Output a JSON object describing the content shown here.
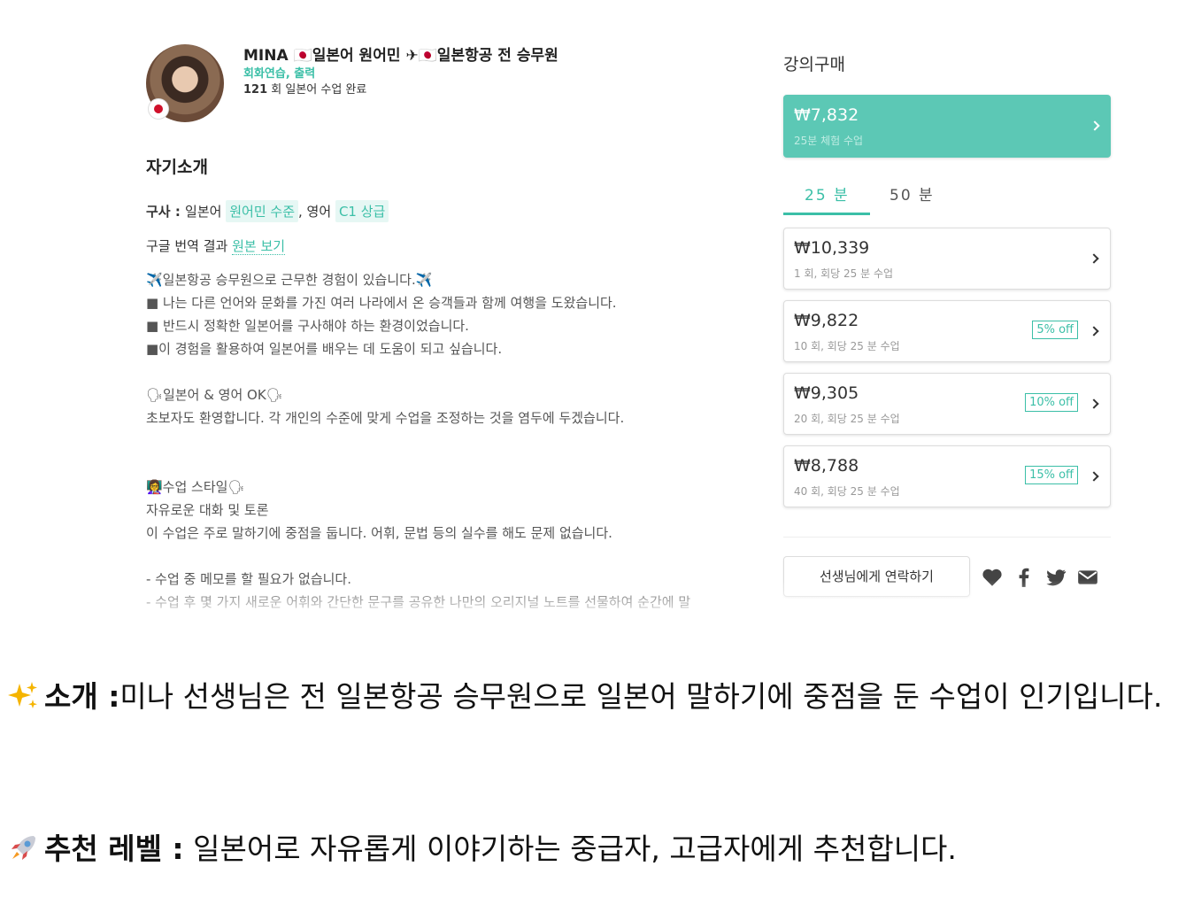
{
  "profile": {
    "name": "MINA 🇯🇵일본어 원어민 ✈🇯🇵일본항공 전 승무원",
    "skills": "회화연습, 출력",
    "lessons_count": "121",
    "lessons_text": " 회 일본어 수업 완료"
  },
  "intro": {
    "title": "자기소개",
    "speaks_label": "구사 : ",
    "lang1": "일본어",
    "lang1_level": "원어민 수준",
    "lang2": ", 영어",
    "lang2_level": "C1 상급",
    "translate_text": "구글 번역 결과",
    "translate_link": "원본 보기",
    "lines": [
      "✈️일본항공 승무원으로 근무한 경험이 있습니다.✈️",
      "■ 나는 다른 언어와 문화를 가진 여러 나라에서 온 승객들과 함께 여행을 도왔습니다.",
      "■ 반드시 정확한 일본어를 구사해야 하는 환경이었습니다.",
      "■이 경험을 활용하여 일본어를 배우는 데 도움이 되고 싶습니다.",
      "",
      "🗣일본어 & 영어 OK🗣",
      "초보자도 환영합니다. 각 개인의 수준에 맞게 수업을 조정하는 것을 염두에 두겠습니다.",
      "",
      "",
      "👩‍🏫수업 스타일🗣",
      "자유로운 대화 및 토론",
      "이 수업은 주로 말하기에 중점을 둡니다. 어휘, 문법 등의 실수를 해도 문제 없습니다.",
      "",
      "- 수업 중 메모를 할 필요가 없습니다.",
      "- 수업 후 몇 가지 새로운 어휘와 간단한 문구를 공유한 나만의 오리지널 노트를 선물하여 순간에 말"
    ]
  },
  "purchase": {
    "title": "강의구매",
    "trial": {
      "price": "₩7,832",
      "sub": "25분 체험 수업"
    },
    "tabs": [
      "25 분",
      "50 분"
    ],
    "options": [
      {
        "price": "₩10,339",
        "sub": "1 회, 회당 25 분 수업",
        "badge": ""
      },
      {
        "price": "₩9,822",
        "sub": "10 회, 회당 25 분 수업",
        "badge": "5% off"
      },
      {
        "price": "₩9,305",
        "sub": "20 회, 회당 25 분 수업",
        "badge": "10% off"
      },
      {
        "price": "₩8,788",
        "sub": "40 회, 회당 25 분 수업",
        "badge": "15% off"
      }
    ],
    "contact": "선생님에게 연락하기",
    "social_icons": [
      "heart-icon",
      "facebook-icon",
      "twitter-icon",
      "mail-icon"
    ],
    "accent_color": "#5cc8b5"
  },
  "caption": {
    "intro_label": "소개 :",
    "intro_text": "미나 선생님은 전 일본항공 승무원으로 일본어 말하기에 중점을 둔 수업이 인기입니다.",
    "level_label": "추천 레벨 :",
    "level_text": " 일본어로 자유롭게 이야기하는 중급자, 고급자에게 추천합니다."
  }
}
